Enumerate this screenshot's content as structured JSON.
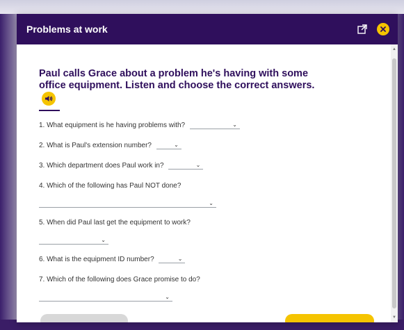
{
  "modal": {
    "title": "Problems at work"
  },
  "instruction": "Paul calls Grace about a problem he's having with some office equipment. Listen and choose the correct answers.",
  "questions": [
    {
      "text": "1. What equipment is he having problems with?",
      "value": ""
    },
    {
      "text": "2. What is Paul's extension number?",
      "value": ""
    },
    {
      "text": "3. Which department does Paul work in?",
      "value": ""
    },
    {
      "text": "4. Which of the following has Paul NOT done?",
      "value": ""
    },
    {
      "text": "5. When did Paul last get the equipment to work?",
      "value": ""
    },
    {
      "text": "6. What is the equipment ID number?",
      "value": ""
    },
    {
      "text": "7. Which of the following does Grace promise to do?",
      "value": ""
    }
  ],
  "icons": {
    "popout": "external-link-icon",
    "close": "close-icon",
    "audio": "speaker-icon"
  },
  "colors": {
    "header": "#2f0f5c",
    "accent": "#f5c400"
  }
}
